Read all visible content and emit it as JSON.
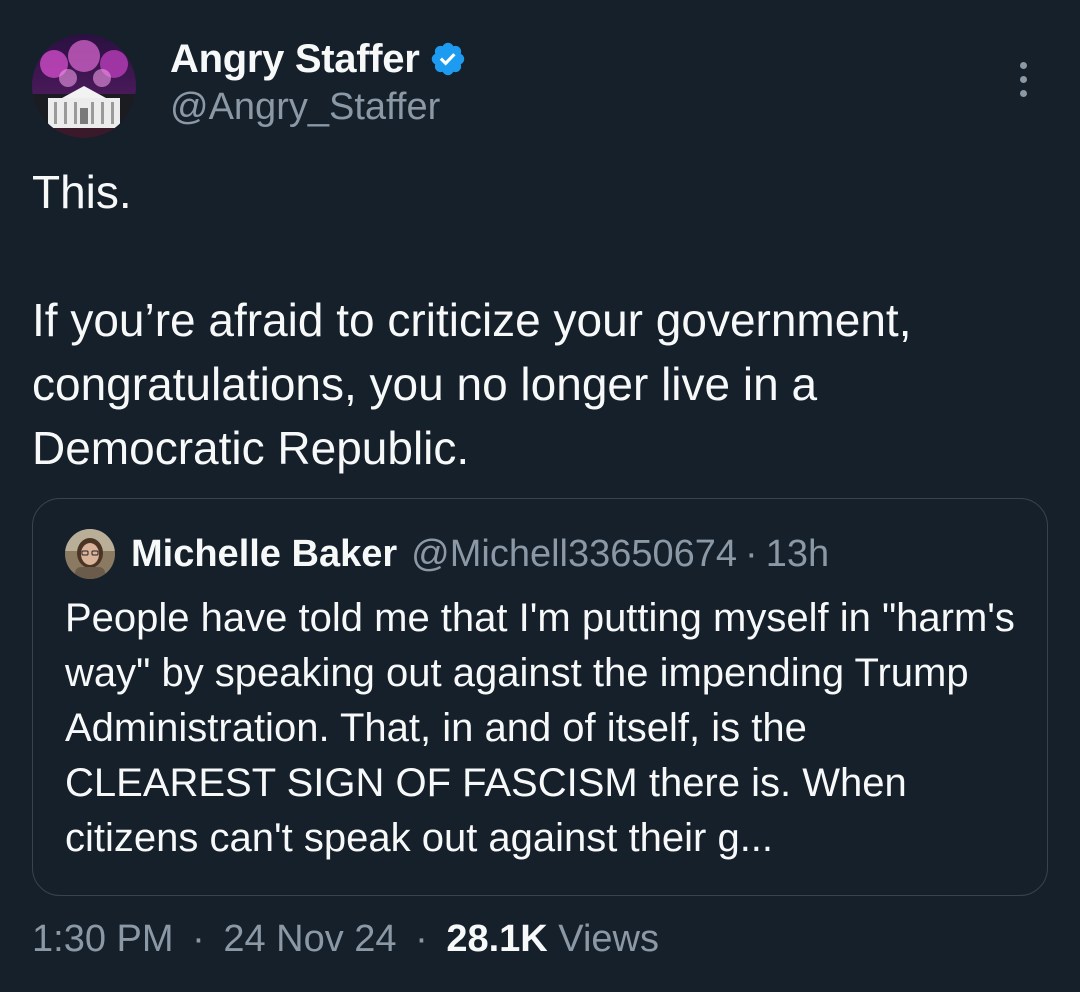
{
  "tweet": {
    "display_name": "Angry Staffer",
    "handle": "@Angry_Staffer",
    "verified": true,
    "text": "This.\n\nIf you’re afraid to criticize your government, congratulations, you no longer live in a Democratic Republic.",
    "avatar_icon": "white-house-fireworks-avatar",
    "more_icon": "more-vertical-icon"
  },
  "quote": {
    "display_name": "Michelle Baker",
    "handle": "@Michell33650674",
    "separator": "·",
    "time": "13h",
    "text": "People have told me that I'm putting myself in \"harm's way\" by speaking out against the impending Trump Administration.  That, in and of itself, is the CLEAREST SIGN OF FASCISM there is.  When citizens can't speak out against their g...",
    "avatar_icon": "user-photo-avatar"
  },
  "footer": {
    "time": "1:30 PM",
    "separator": "·",
    "date": "24 Nov 24",
    "views_count": "28.1K",
    "views_label": "Views"
  },
  "colors": {
    "background": "#15202b",
    "text_primary": "#f7f9f9",
    "text_secondary": "#8b98a5",
    "verified_blue": "#1d9bf0",
    "border": "#38444d"
  }
}
